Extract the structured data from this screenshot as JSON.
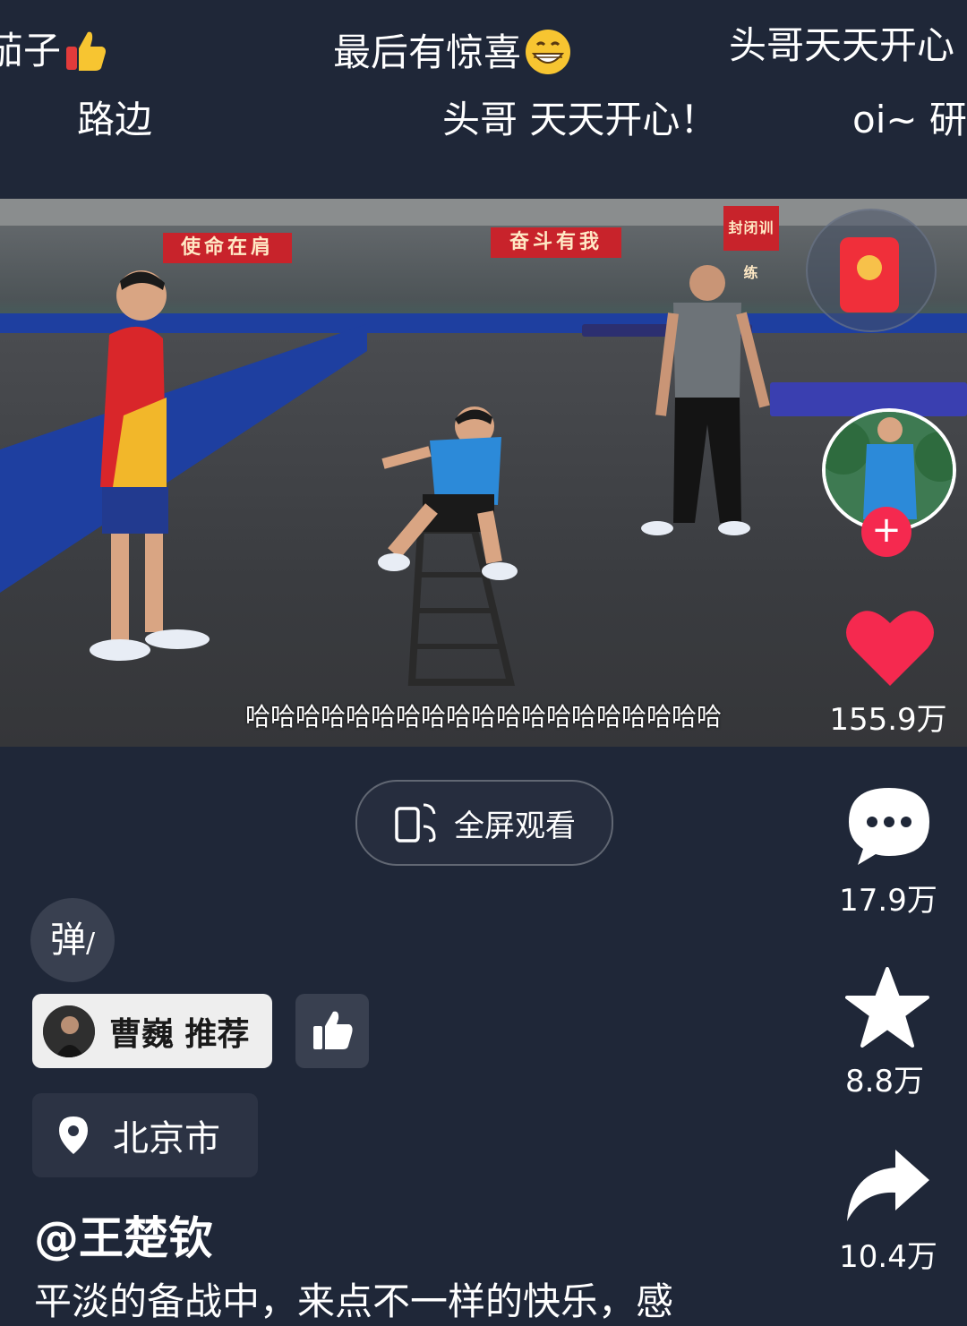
{
  "danmaku": {
    "row1": [
      "茄子",
      "最后有惊喜",
      "头哥天天开心"
    ],
    "row2": [
      "路边",
      "头哥 天天开心！",
      "oi~ 研"
    ]
  },
  "video": {
    "banners": [
      "使命在肩",
      "奋斗有我",
      "封闭训练"
    ],
    "subtitle": "哈哈哈哈哈哈哈哈哈哈哈哈哈哈哈哈哈哈哈"
  },
  "rail": {
    "like_count": "155.9万",
    "comment_count": "17.9万",
    "favorite_count": "8.8万",
    "share_count": "10.4万"
  },
  "fullscreen_label": "全屏观看",
  "danmu_toggle_label": "弹",
  "recommend_label": "曹巍 推荐",
  "location_label": "北京市",
  "author": "@王楚钦",
  "caption": "平淡的备战中，来点不一样的快乐，感",
  "colors": {
    "background": "#1f2738",
    "like_red": "#f5294f",
    "chip_dark": "#394050"
  }
}
